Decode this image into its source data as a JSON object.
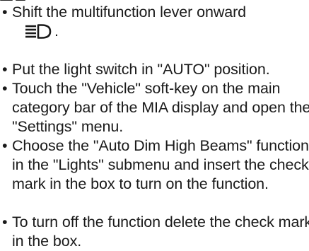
{
  "instructions": [
    {
      "text_line1": "Shift the multifunction lever onward",
      "icon": "high-beam-icon",
      "text_after_icon": "."
    },
    {
      "text": "Put the light switch in \"AUTO\" position."
    },
    {
      "text": "Touch the \"Vehicle\" soft-key on the main category bar of the MIA display and open the \"Settings\" menu."
    },
    {
      "text": "Choose the \"Auto Dim High Beams\" function in the \"Lights\" submenu and insert the check mark in the box to turn on the function."
    },
    {
      "text": "To turn off the function delete the check mark in the box."
    }
  ],
  "bullet_symbol": "•",
  "colors": {
    "text": "#1a1a1a",
    "background": "#ffffff"
  }
}
